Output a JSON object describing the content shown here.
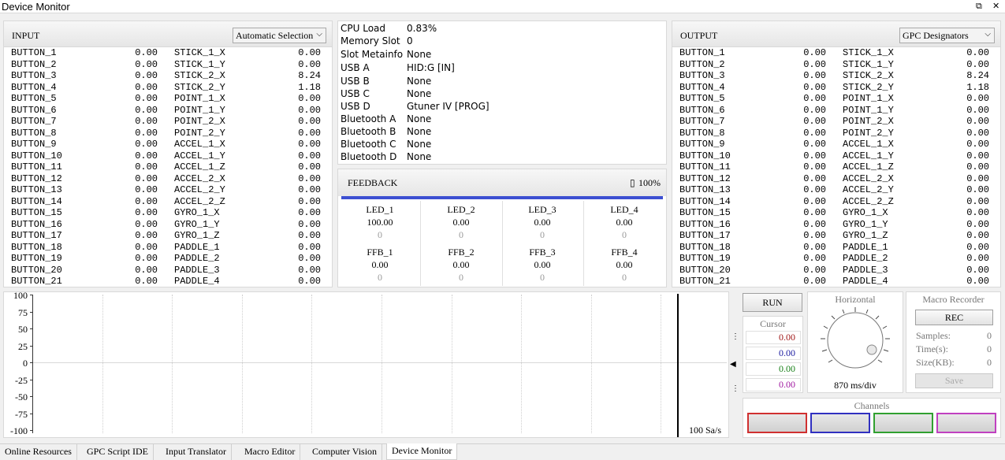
{
  "window": {
    "title": "Device Monitor",
    "restore_glyph": "⧉",
    "close_glyph": "✕"
  },
  "input": {
    "label": "INPUT",
    "mode": "Automatic Selection",
    "rows": [
      [
        "BUTTON_1",
        "0.00",
        "STICK_1_X",
        "0.00"
      ],
      [
        "BUTTON_2",
        "0.00",
        "STICK_1_Y",
        "0.00"
      ],
      [
        "BUTTON_3",
        "0.00",
        "STICK_2_X",
        "8.24"
      ],
      [
        "BUTTON_4",
        "0.00",
        "STICK_2_Y",
        "1.18"
      ],
      [
        "BUTTON_5",
        "0.00",
        "POINT_1_X",
        "0.00"
      ],
      [
        "BUTTON_6",
        "0.00",
        "POINT_1_Y",
        "0.00"
      ],
      [
        "BUTTON_7",
        "0.00",
        "POINT_2_X",
        "0.00"
      ],
      [
        "BUTTON_8",
        "0.00",
        "POINT_2_Y",
        "0.00"
      ],
      [
        "BUTTON_9",
        "0.00",
        "ACCEL_1_X",
        "0.00"
      ],
      [
        "BUTTON_10",
        "0.00",
        "ACCEL_1_Y",
        "0.00"
      ],
      [
        "BUTTON_11",
        "0.00",
        "ACCEL_1_Z",
        "0.00"
      ],
      [
        "BUTTON_12",
        "0.00",
        "ACCEL_2_X",
        "0.00"
      ],
      [
        "BUTTON_13",
        "0.00",
        "ACCEL_2_Y",
        "0.00"
      ],
      [
        "BUTTON_14",
        "0.00",
        "ACCEL_2_Z",
        "0.00"
      ],
      [
        "BUTTON_15",
        "0.00",
        "GYRO_1_X",
        "0.00"
      ],
      [
        "BUTTON_16",
        "0.00",
        "GYRO_1_Y",
        "0.00"
      ],
      [
        "BUTTON_17",
        "0.00",
        "GYRO_1_Z",
        "0.00"
      ],
      [
        "BUTTON_18",
        "0.00",
        "PADDLE_1",
        "0.00"
      ],
      [
        "BUTTON_19",
        "0.00",
        "PADDLE_2",
        "0.00"
      ],
      [
        "BUTTON_20",
        "0.00",
        "PADDLE_3",
        "0.00"
      ],
      [
        "BUTTON_21",
        "0.00",
        "PADDLE_4",
        "0.00"
      ]
    ]
  },
  "output": {
    "label": "OUTPUT",
    "mode": "GPC Designators",
    "rows": [
      [
        "BUTTON_1",
        "0.00",
        "STICK_1_X",
        "0.00"
      ],
      [
        "BUTTON_2",
        "0.00",
        "STICK_1_Y",
        "0.00"
      ],
      [
        "BUTTON_3",
        "0.00",
        "STICK_2_X",
        "8.24"
      ],
      [
        "BUTTON_4",
        "0.00",
        "STICK_2_Y",
        "1.18"
      ],
      [
        "BUTTON_5",
        "0.00",
        "POINT_1_X",
        "0.00"
      ],
      [
        "BUTTON_6",
        "0.00",
        "POINT_1_Y",
        "0.00"
      ],
      [
        "BUTTON_7",
        "0.00",
        "POINT_2_X",
        "0.00"
      ],
      [
        "BUTTON_8",
        "0.00",
        "POINT_2_Y",
        "0.00"
      ],
      [
        "BUTTON_9",
        "0.00",
        "ACCEL_1_X",
        "0.00"
      ],
      [
        "BUTTON_10",
        "0.00",
        "ACCEL_1_Y",
        "0.00"
      ],
      [
        "BUTTON_11",
        "0.00",
        "ACCEL_1_Z",
        "0.00"
      ],
      [
        "BUTTON_12",
        "0.00",
        "ACCEL_2_X",
        "0.00"
      ],
      [
        "BUTTON_13",
        "0.00",
        "ACCEL_2_Y",
        "0.00"
      ],
      [
        "BUTTON_14",
        "0.00",
        "ACCEL_2_Z",
        "0.00"
      ],
      [
        "BUTTON_15",
        "0.00",
        "GYRO_1_X",
        "0.00"
      ],
      [
        "BUTTON_16",
        "0.00",
        "GYRO_1_Y",
        "0.00"
      ],
      [
        "BUTTON_17",
        "0.00",
        "GYRO_1_Z",
        "0.00"
      ],
      [
        "BUTTON_18",
        "0.00",
        "PADDLE_1",
        "0.00"
      ],
      [
        "BUTTON_19",
        "0.00",
        "PADDLE_2",
        "0.00"
      ],
      [
        "BUTTON_20",
        "0.00",
        "PADDLE_3",
        "0.00"
      ],
      [
        "BUTTON_21",
        "0.00",
        "PADDLE_4",
        "0.00"
      ]
    ]
  },
  "status": {
    "cpu_load": {
      "label": "CPU Load",
      "value": "0.83%"
    },
    "memory_slot": {
      "label": "Memory Slot",
      "value": "0"
    },
    "slot_metainfo": {
      "label": "Slot Metainfo",
      "value": "None"
    },
    "usb_a": {
      "label": "USB A",
      "value": "HID:G [IN]"
    },
    "usb_b": {
      "label": "USB B",
      "value": "None"
    },
    "usb_c": {
      "label": "USB C",
      "value": "None"
    },
    "usb_d": {
      "label": "USB D",
      "value": "Gtuner IV [PROG]"
    },
    "bt_a": {
      "label": "Bluetooth A",
      "value": "None"
    },
    "bt_b": {
      "label": "Bluetooth B",
      "value": "None"
    },
    "bt_c": {
      "label": "Bluetooth C",
      "value": "None"
    },
    "bt_d": {
      "label": "Bluetooth D",
      "value": "None"
    }
  },
  "feedback": {
    "label": "FEEDBACK",
    "battery": "100%",
    "leds": [
      {
        "name": "LED_1",
        "value": "100.00",
        "raw": "0"
      },
      {
        "name": "LED_2",
        "value": "0.00",
        "raw": "0"
      },
      {
        "name": "LED_3",
        "value": "0.00",
        "raw": "0"
      },
      {
        "name": "LED_4",
        "value": "0.00",
        "raw": "0"
      }
    ],
    "ffb": [
      {
        "name": "FFB_1",
        "value": "0.00",
        "raw": "0"
      },
      {
        "name": "FFB_2",
        "value": "0.00",
        "raw": "0"
      },
      {
        "name": "FFB_3",
        "value": "0.00",
        "raw": "0"
      },
      {
        "name": "FFB_4",
        "value": "0.00",
        "raw": "0"
      }
    ]
  },
  "scope": {
    "y_ticks": [
      "100",
      "75",
      "50",
      "25",
      "0",
      "-25",
      "-50",
      "-75",
      "-100"
    ],
    "sample_rate": "100 Sa/s"
  },
  "controls": {
    "run_label": "RUN",
    "cursor_label": "Cursor",
    "cursor_values": [
      "0.00",
      "0.00",
      "0.00",
      "0.00"
    ],
    "cursor_colors": [
      "#a01818",
      "#1a1aa0",
      "#188018",
      "#a018a0"
    ],
    "horizontal_label": "Horizontal",
    "horizontal_value": "870 ms/div",
    "channels_label": "Channels",
    "channel_colors": [
      "#d03030",
      "#3030c0",
      "#30a030",
      "#c040c0"
    ]
  },
  "macro": {
    "title": "Macro Recorder",
    "rec_label": "REC",
    "samples_label": "Samples:",
    "samples_value": "0",
    "time_label": "Time(s):",
    "time_value": "0",
    "size_label": "Size(KB):",
    "size_value": "0",
    "save_label": "Save"
  },
  "tabs": [
    "Online Resources",
    "GPC Script IDE",
    "Input Translator",
    "Macro Editor",
    "Computer Vision",
    "Device Monitor"
  ],
  "active_tab": "Device Monitor"
}
